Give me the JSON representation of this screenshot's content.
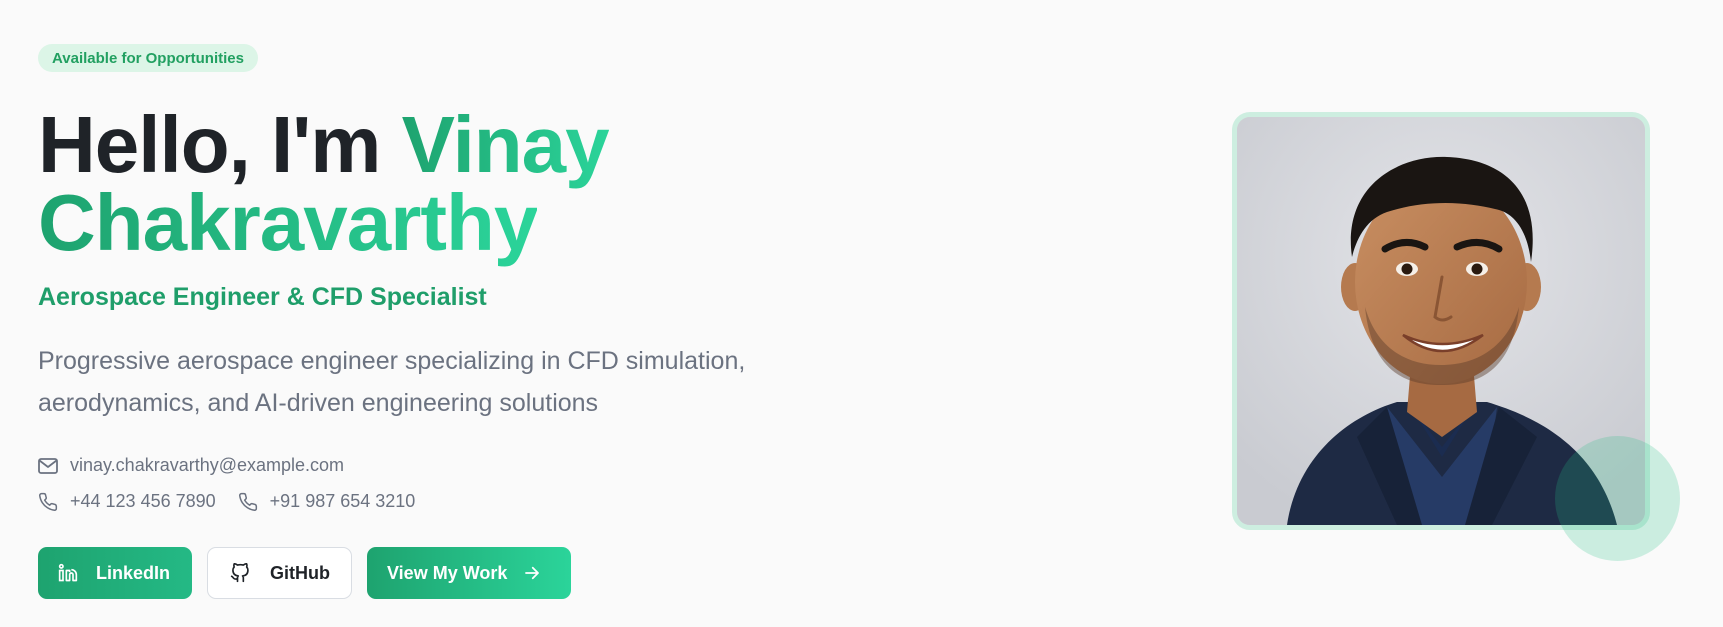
{
  "hero": {
    "badge": "Available for Opportunities",
    "greeting": "Hello, I'm",
    "first_name": "Vinay",
    "last_name": "Chakravarthy",
    "role": "Aerospace Engineer & CFD Specialist",
    "description": "Progressive aerospace engineer specializing in CFD simulation, aerodynamics, and AI-driven engineering solutions"
  },
  "contact": {
    "email": "vinay.chakravarthy@example.com",
    "phone_uk": "+44 123 456 7890",
    "phone_in": "+91 987 654 3210"
  },
  "actions": {
    "linkedin": "LinkedIn",
    "github": "GitHub",
    "view_work": "View My Work"
  },
  "icons": {
    "email": "mail-icon",
    "phone": "phone-icon",
    "linkedin": "linkedin-icon",
    "github": "github-icon",
    "arrow": "arrow-right-icon"
  },
  "colors": {
    "accent": "#1ea36f",
    "accent_light": "#2bd49a",
    "badge_bg": "#dcf5e7",
    "heading": "#1f2328",
    "muted": "#6b7280",
    "background": "#fafafa"
  }
}
